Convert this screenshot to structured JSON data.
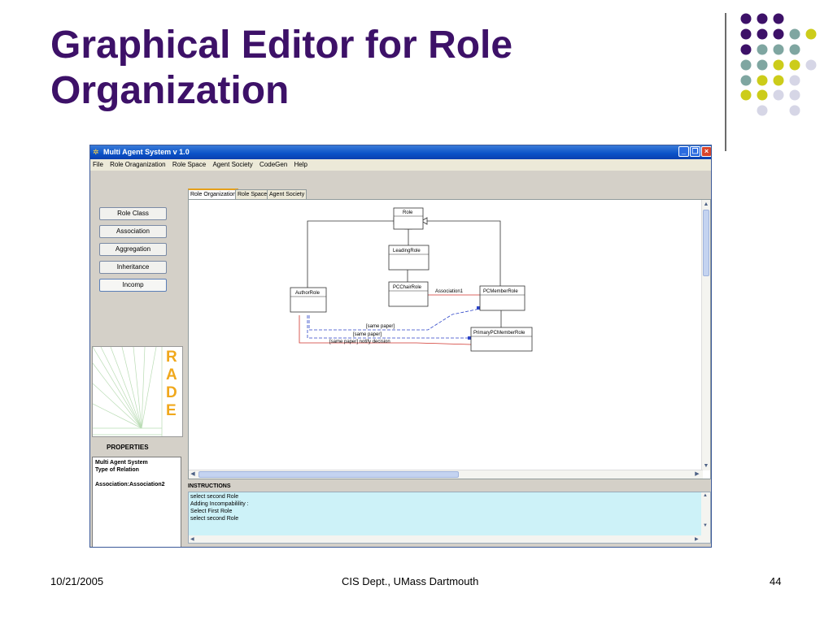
{
  "slide": {
    "title_line1": "Graphical Editor for Role",
    "title_line2": "Organization",
    "footer_date": "10/21/2005",
    "footer_center": "CIS Dept., UMass Dartmouth",
    "footer_page": "44",
    "colors": {
      "title": "#3d1168",
      "dot_purple": "#3d1168",
      "dot_teal": "#7fa6a1",
      "dot_yellow": "#cccc1a",
      "dot_lavender": "#d6d6e6"
    }
  },
  "window": {
    "title": "Multi Agent System v 1.0",
    "controls": [
      "minimize-icon",
      "restore-icon",
      "close-icon"
    ],
    "menu": [
      "File",
      "Role Oraganization",
      "Role Space",
      "Agent Society",
      "CodeGen",
      "Help"
    ]
  },
  "toolbox": {
    "buttons": [
      "Role Class",
      "Association",
      "Aggregation",
      "Inheritance",
      "Incomp"
    ]
  },
  "logo": {
    "letters": [
      "R",
      "A",
      "D",
      "E"
    ]
  },
  "properties": {
    "title": "PROPERTIES",
    "lines": [
      "Multi Agent System",
      "Type of Relation",
      "",
      "Association:Association2"
    ]
  },
  "tabs": [
    "Role Organization",
    "Role Space",
    "Agent Society"
  ],
  "diagram": {
    "classes": {
      "role": "Role",
      "leading": "LeadingRole",
      "pcchair": "PCChairRole",
      "author": "AuthorRole",
      "pcmember": "PCMemberRole",
      "primary": "PrimaryPCMemberRole"
    },
    "labels": {
      "assoc1": "Association1",
      "same_paper_1": "[same paper]",
      "same_paper_2": "[same paper]",
      "notify": "[same paper] notify decision"
    }
  },
  "instructions": {
    "title": "INSTRUCTIONS",
    "lines": [
      " select second Role",
      "Adding Incompabilility :",
      " Select First Role",
      " select second Role"
    ]
  }
}
